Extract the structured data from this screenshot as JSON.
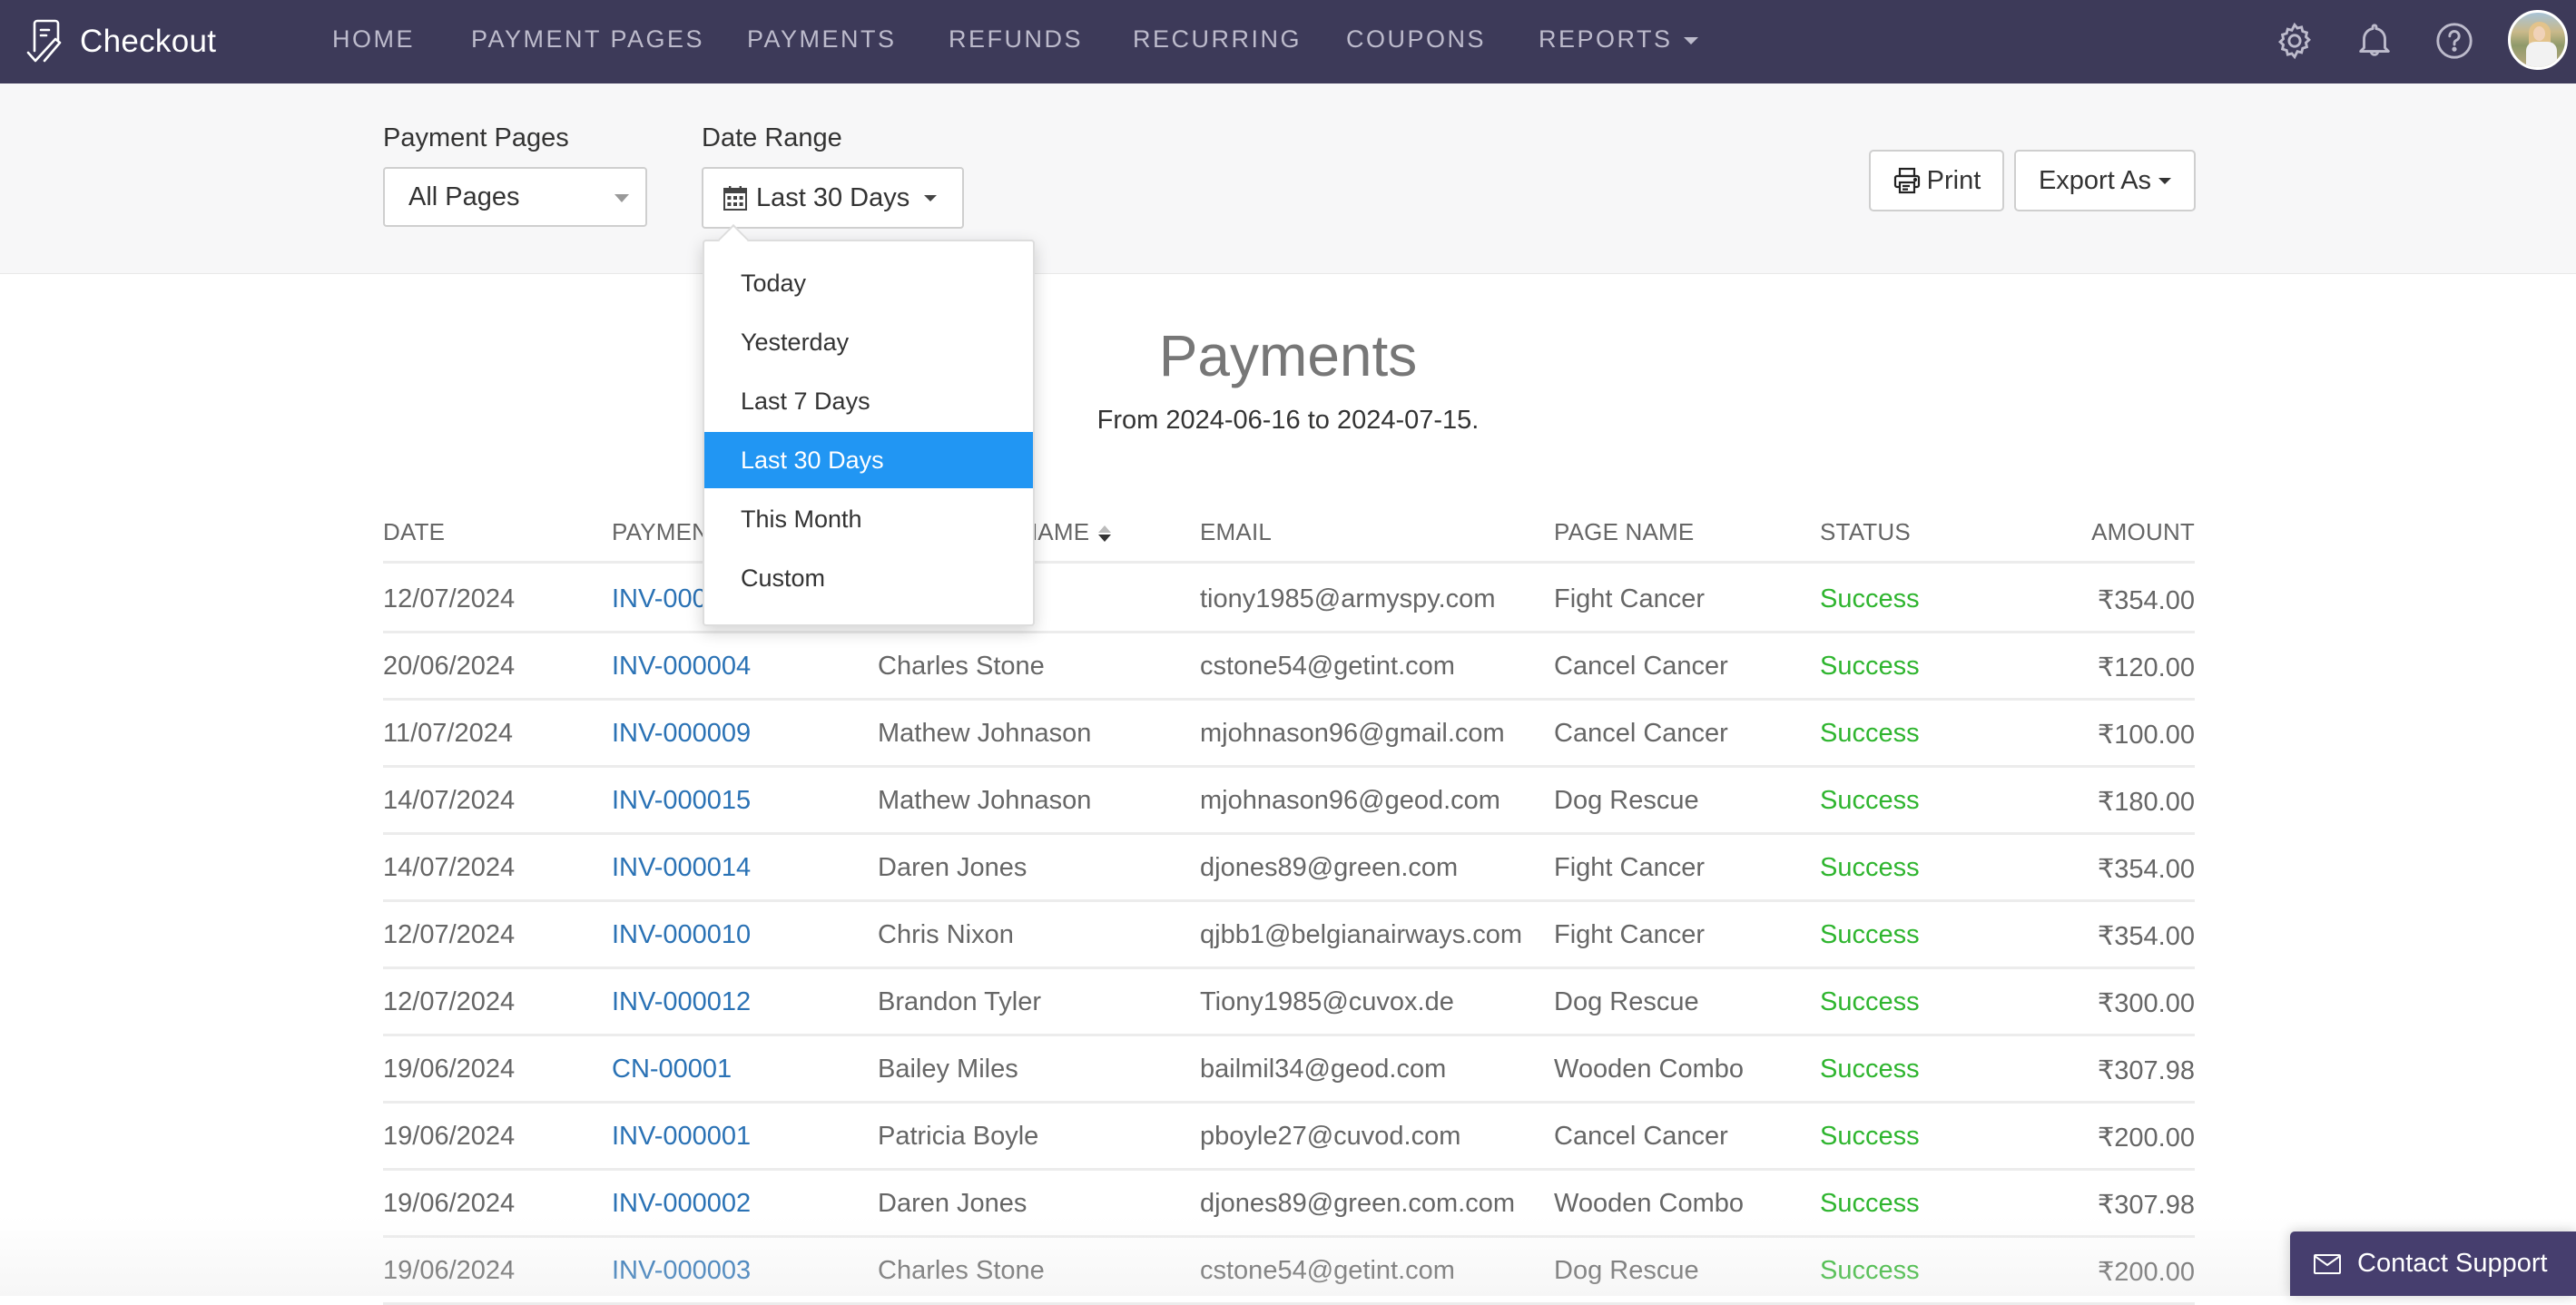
{
  "app": {
    "brand_name": "Checkout",
    "logo_icon": "checkout-document-check-icon"
  },
  "nav": {
    "items": [
      {
        "label": "HOME"
      },
      {
        "label": "PAYMENT PAGES"
      },
      {
        "label": "PAYMENTS"
      },
      {
        "label": "REFUNDS"
      },
      {
        "label": "RECURRING"
      },
      {
        "label": "COUPONS"
      },
      {
        "label": "REPORTS",
        "has_dropdown": true
      }
    ],
    "icons": [
      "gear-icon",
      "bell-icon",
      "help-circle-icon",
      "user-avatar"
    ]
  },
  "filters": {
    "payment_pages": {
      "label": "Payment Pages",
      "value": "All Pages"
    },
    "date_range": {
      "label": "Date Range",
      "value": "Last 30 Days",
      "icon": "calendar-icon"
    },
    "print_label": "Print",
    "export_label": "Export As"
  },
  "date_dropdown": {
    "options": [
      "Today",
      "Yesterday",
      "Last 7 Days",
      "Last 30 Days",
      "This Month",
      "Custom"
    ],
    "selected": "Last 30 Days"
  },
  "report": {
    "title": "Payments",
    "subtitle": "From 2024-06-16 to 2024-07-15."
  },
  "table": {
    "columns": [
      "DATE",
      "PAYMENT #",
      "CUSTOMER NAME",
      "EMAIL",
      "PAGE NAME",
      "STATUS",
      "AMOUNT"
    ],
    "visible_header_fragments": {
      "payment": "PAYMEN",
      "customer": "AME"
    },
    "rows": [
      {
        "date": "12/07/2024",
        "payment": "INV-000",
        "customer": "",
        "email": "tiony1985@armyspy.com",
        "page": "Fight Cancer",
        "status": "Success",
        "amount": "₹354.00"
      },
      {
        "date": "20/06/2024",
        "payment": "INV-000004",
        "customer": "Charles Stone",
        "email": "cstone54@getint.com",
        "page": "Cancel Cancer",
        "status": "Success",
        "amount": "₹120.00"
      },
      {
        "date": "11/07/2024",
        "payment": "INV-000009",
        "customer": "Mathew Johnason",
        "email": "mjohnason96@gmail.com",
        "page": "Cancel Cancer",
        "status": "Success",
        "amount": "₹100.00"
      },
      {
        "date": "14/07/2024",
        "payment": "INV-000015",
        "customer": "Mathew Johnason",
        "email": "mjohnason96@geod.com",
        "page": "Dog Rescue",
        "status": "Success",
        "amount": "₹180.00"
      },
      {
        "date": "14/07/2024",
        "payment": "INV-000014",
        "customer": "Daren Jones",
        "email": "djones89@green.com",
        "page": "Fight Cancer",
        "status": "Success",
        "amount": "₹354.00"
      },
      {
        "date": "12/07/2024",
        "payment": "INV-000010",
        "customer": "Chris Nixon",
        "email": "qjbb1@belgianairways.com",
        "page": "Fight Cancer",
        "status": "Success",
        "amount": "₹354.00"
      },
      {
        "date": "12/07/2024",
        "payment": "INV-000012",
        "customer": "Brandon Tyler",
        "email": "Tiony1985@cuvox.de",
        "page": "Dog Rescue",
        "status": "Success",
        "amount": "₹300.00"
      },
      {
        "date": "19/06/2024",
        "payment": "CN-00001",
        "customer": "Bailey Miles",
        "email": "bailmil34@geod.com",
        "page": "Wooden Combo",
        "status": "Success",
        "amount": "₹307.98"
      },
      {
        "date": "19/06/2024",
        "payment": "INV-000001",
        "customer": "Patricia Boyle",
        "email": "pboyle27@cuvod.com",
        "page": "Cancel Cancer",
        "status": "Success",
        "amount": "₹200.00"
      },
      {
        "date": "19/06/2024",
        "payment": "INV-000002",
        "customer": "Daren Jones",
        "email": "djones89@green.com.com",
        "page": "Wooden Combo",
        "status": "Success",
        "amount": "₹307.98"
      },
      {
        "date": "19/06/2024",
        "payment": "INV-000003",
        "customer": "Charles Stone",
        "email": "cstone54@getint.com",
        "page": "Dog Rescue",
        "status": "Success",
        "amount": "₹200.00"
      }
    ]
  },
  "support": {
    "label": "Contact Support",
    "icon": "mail-icon"
  },
  "colors": {
    "navbar": "#3d3a59",
    "link": "#2a72b5",
    "success": "#2fb52f",
    "dropdown_active": "#2196f3",
    "support_button": "#463e6e"
  }
}
